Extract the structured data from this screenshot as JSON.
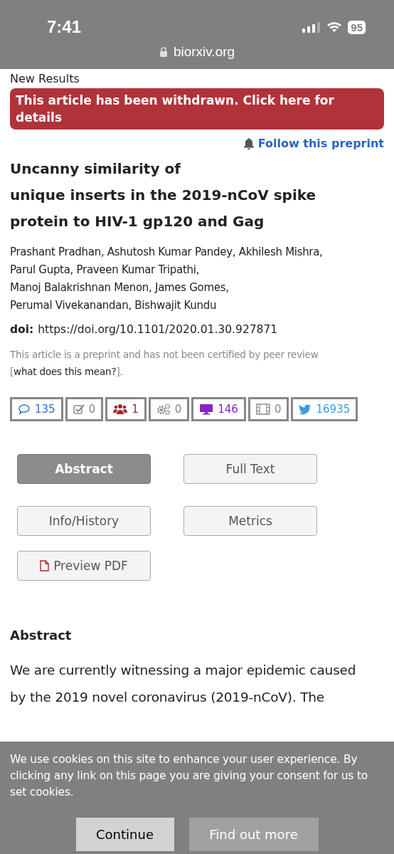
{
  "status_bar": {
    "time": "7:41",
    "battery": "95"
  },
  "address_bar": {
    "url": "biorxiv.org"
  },
  "section_label": "New Results",
  "withdrawn_notice": "This article has been withdrawn. Click here for details",
  "follow_link": "Follow this preprint",
  "title": [
    "Uncanny similarity of",
    "unique inserts in the 2019-nCoV spike",
    "protein to HIV-1 gp120 and Gag"
  ],
  "authors": [
    "Prashant Pradhan, Ashutosh Kumar Pandey, Akhilesh Mishra,",
    "Parul Gupta, Praveen Kumar Tripathi,",
    "Manoj Balakrishnan Menon, James Gomes,",
    "Perumal Vivekanandan, Bishwajit Kundu"
  ],
  "doi": {
    "label": "doi:",
    "url": "https://doi.org/10.1101/2020.01.30.927871"
  },
  "preprint_note": {
    "text": "This article is a preprint and has not been certified by peer review",
    "open": "[",
    "link": "what does this mean?",
    "close": "]."
  },
  "metrics": [
    {
      "kind": "comment",
      "count": "135",
      "color": "#2a6fd6"
    },
    {
      "kind": "check",
      "count": "0",
      "color": "#888888"
    },
    {
      "kind": "people",
      "count": "1",
      "color": "#a8282c"
    },
    {
      "kind": "gears",
      "count": "0",
      "color": "#888888"
    },
    {
      "kind": "monitor",
      "count": "146",
      "color": "#8a22c8"
    },
    {
      "kind": "film",
      "count": "0",
      "color": "#888888"
    },
    {
      "kind": "bird",
      "count": "16935",
      "color": "#3a9be0"
    }
  ],
  "tabs": [
    {
      "label": "Abstract",
      "selected": true
    },
    {
      "label": "Full Text",
      "selected": false
    },
    {
      "label": "Info/History",
      "selected": false
    },
    {
      "label": "Metrics",
      "selected": false
    },
    {
      "label": "Preview PDF",
      "selected": false,
      "kind": "pdf"
    }
  ],
  "abstract": {
    "heading": "Abstract",
    "lines": [
      "We are currently witnessing a major epidemic caused",
      "by the 2019 novel coronavirus (2019-nCoV). The"
    ]
  },
  "cookie_banner": {
    "text": "We use cookies on this site to enhance your user experience. By clicking any link on this page you are giving your consent for us to set cookies.",
    "buttons": [
      "Continue",
      "Find out more"
    ]
  }
}
